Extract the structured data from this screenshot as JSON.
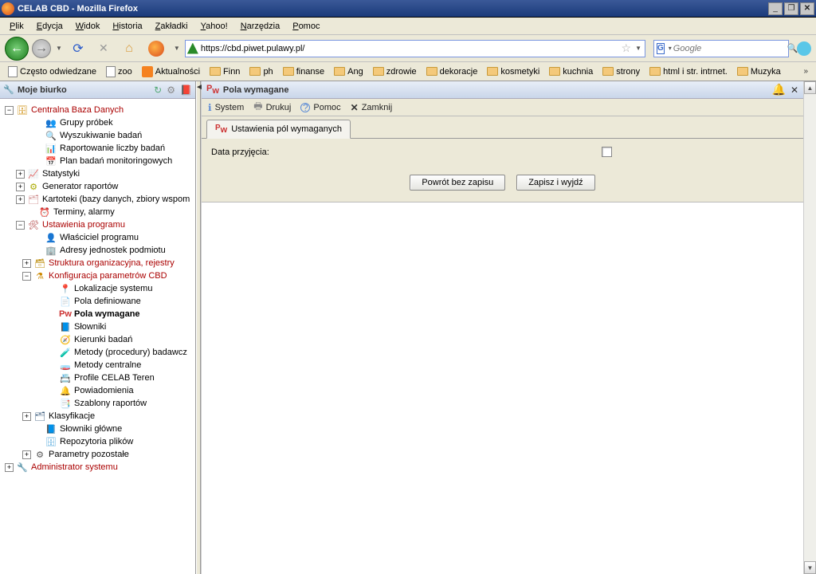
{
  "window": {
    "title": "CELAB CBD - Mozilla Firefox"
  },
  "menubar": [
    "Plik",
    "Edycja",
    "Widok",
    "Historia",
    "Zakładki",
    "Yahoo!",
    "Narzędzia",
    "Pomoc"
  ],
  "url": "https://cbd.piwet.pulawy.pl/",
  "search_placeholder": "Google",
  "bookmarks": [
    {
      "label": "Często odwiedzane",
      "icon": "page"
    },
    {
      "label": "zoo",
      "icon": "page"
    },
    {
      "label": "Aktualności",
      "icon": "rss"
    },
    {
      "label": "Finn",
      "icon": "folder"
    },
    {
      "label": "ph",
      "icon": "folder"
    },
    {
      "label": "finanse",
      "icon": "folder"
    },
    {
      "label": "Ang",
      "icon": "folder"
    },
    {
      "label": "zdrowie",
      "icon": "folder"
    },
    {
      "label": "dekoracje",
      "icon": "folder"
    },
    {
      "label": "kosmetyki",
      "icon": "folder"
    },
    {
      "label": "kuchnia",
      "icon": "folder"
    },
    {
      "label": "strony",
      "icon": "folder"
    },
    {
      "label": "html i str. intrnet.",
      "icon": "folder"
    },
    {
      "label": "Muzyka",
      "icon": "folder"
    }
  ],
  "sidebar": {
    "title": "Moje biurko"
  },
  "tree": [
    {
      "pad": 6,
      "exp": "minus",
      "ico": "db",
      "label": "Centralna Baza Danych",
      "red": true
    },
    {
      "pad": 42,
      "exp": "none",
      "ico": "group",
      "label": "Grupy próbek"
    },
    {
      "pad": 42,
      "exp": "none",
      "ico": "search",
      "label": "Wyszukiwanie badań"
    },
    {
      "pad": 42,
      "exp": "none",
      "ico": "report",
      "label": "Raportowanie liczby badań"
    },
    {
      "pad": 42,
      "exp": "none",
      "ico": "plan",
      "label": "Plan badań monitoringowych"
    },
    {
      "pad": 20,
      "exp": "plus",
      "ico": "stat",
      "label": "Statystyki"
    },
    {
      "pad": 20,
      "exp": "plus",
      "ico": "gen",
      "label": "Generator raportów"
    },
    {
      "pad": 20,
      "exp": "plus",
      "ico": "kart",
      "label": "Kartoteki (bazy danych, zbiory wspom"
    },
    {
      "pad": 34,
      "exp": "none",
      "ico": "clock",
      "label": "Terminy, alarmy"
    },
    {
      "pad": 20,
      "exp": "minus",
      "ico": "set",
      "label": "Ustawienia programu",
      "red": true
    },
    {
      "pad": 42,
      "exp": "none",
      "ico": "own",
      "label": "Właściciel programu"
    },
    {
      "pad": 42,
      "exp": "none",
      "ico": "addr",
      "label": "Adresy jednostek podmiotu"
    },
    {
      "pad": 28,
      "exp": "plus",
      "ico": "org",
      "label": "Struktura organizacyjna, rejestry",
      "red": true
    },
    {
      "pad": 28,
      "exp": "minus",
      "ico": "conf",
      "label": "Konfiguracja parametrów CBD",
      "red": true
    },
    {
      "pad": 60,
      "exp": "none",
      "ico": "loc",
      "label": "Lokalizacje systemu"
    },
    {
      "pad": 60,
      "exp": "none",
      "ico": "def",
      "label": "Pola definiowane"
    },
    {
      "pad": 60,
      "exp": "none",
      "ico": "req",
      "label": "Pola wymagane",
      "bold": true
    },
    {
      "pad": 60,
      "exp": "none",
      "ico": "dict",
      "label": "Słowniki"
    },
    {
      "pad": 60,
      "exp": "none",
      "ico": "dir",
      "label": "Kierunki badań"
    },
    {
      "pad": 60,
      "exp": "none",
      "ico": "meth",
      "label": "Metody (procedury) badawcz"
    },
    {
      "pad": 60,
      "exp": "none",
      "ico": "methc",
      "label": "Metody centralne"
    },
    {
      "pad": 60,
      "exp": "none",
      "ico": "prof",
      "label": "Profile CELAB Teren"
    },
    {
      "pad": 60,
      "exp": "none",
      "ico": "notif",
      "label": "Powiadomienia"
    },
    {
      "pad": 60,
      "exp": "none",
      "ico": "tmpl",
      "label": "Szablony raportów"
    },
    {
      "pad": 28,
      "exp": "plus",
      "ico": "klas",
      "label": "Klasyfikacje"
    },
    {
      "pad": 42,
      "exp": "none",
      "ico": "slog",
      "label": "Słowniki główne"
    },
    {
      "pad": 42,
      "exp": "none",
      "ico": "repo",
      "label": "Repozytoria plików"
    },
    {
      "pad": 28,
      "exp": "plus",
      "ico": "param",
      "label": "Parametry pozostałe"
    },
    {
      "pad": 6,
      "exp": "plus",
      "ico": "admin",
      "label": "Administrator systemu",
      "red": true
    }
  ],
  "panel": {
    "title": "Pola wymagane",
    "toolbar": {
      "system": "System",
      "print": "Drukuj",
      "help": "Pomoc",
      "close": "Zamknij"
    },
    "tab": "Ustawienia pól wymaganych",
    "field_label": "Data przyjęcia:",
    "btn_back": "Powrót bez zapisu",
    "btn_save": "Zapisz i wyjdź"
  }
}
